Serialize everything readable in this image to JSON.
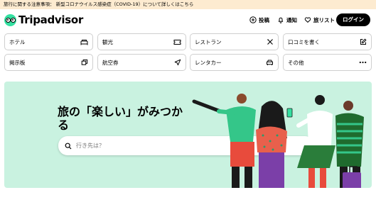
{
  "alert": {
    "text": "旅行に関する注意事項： 新型コロナウイルス感染症（COVID-19）について詳しくはこちら"
  },
  "header": {
    "logo_text": "Tripadvisor",
    "nav": [
      {
        "label": "投稿",
        "icon": "plus-circle-icon"
      },
      {
        "label": "通知",
        "icon": "bell-icon"
      },
      {
        "label": "旅リスト",
        "icon": "heart-icon"
      }
    ],
    "login_label": "ログイン"
  },
  "categories": [
    {
      "label": "ホテル",
      "icon": "bed-icon"
    },
    {
      "label": "観光",
      "icon": "ticket-icon"
    },
    {
      "label": "レストラン",
      "icon": "fork-knife-icon"
    },
    {
      "label": "口コミを書く",
      "icon": "edit-icon"
    },
    {
      "label": "掲示板",
      "icon": "forum-icon"
    },
    {
      "label": "航空券",
      "icon": "airplane-icon"
    },
    {
      "label": "レンタカー",
      "icon": "car-icon"
    },
    {
      "label": "その他",
      "icon": "more-dots-icon"
    }
  ],
  "hero": {
    "title": "旅の「楽しい」がみつかる",
    "search_placeholder": "行き先は？"
  },
  "colors": {
    "brand": "#34e0a1",
    "hero_bg": "#c9f2e0",
    "alert_bg": "#fdebd0"
  }
}
